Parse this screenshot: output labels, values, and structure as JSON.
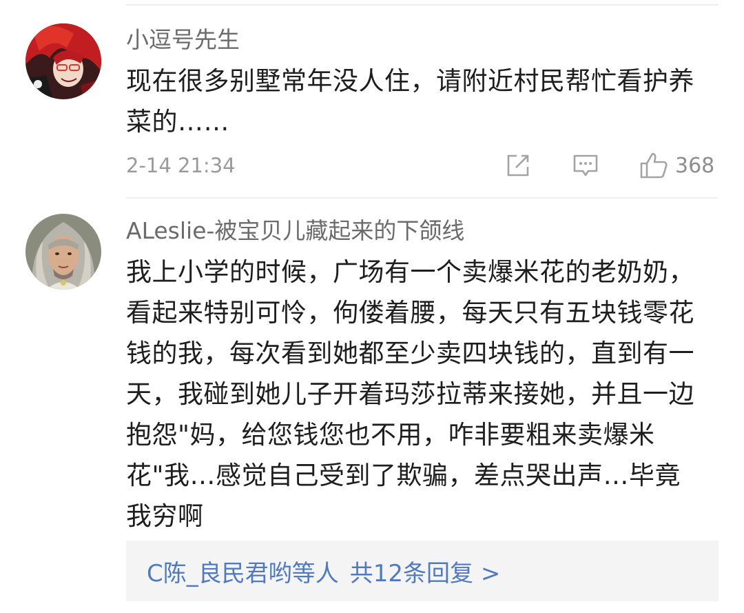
{
  "comments": [
    {
      "username": "小逗号先生",
      "avatar_icon": "avatar-red-haired-anime-character",
      "body_lines": [
        "现在很多别墅常年没人住，请附近村民帮忙看护养",
        "菜的……"
      ],
      "timestamp": "2-14 21:34",
      "actions": {
        "share_icon": "share-icon",
        "reply_icon": "comment-icon",
        "like_icon": "thumbs-up-icon",
        "like_count": "368"
      }
    },
    {
      "username": "ALeslie-被宝贝儿藏起来的下颌线",
      "avatar_icon": "avatar-grey-haired-portrait",
      "body_lines": [
        "我上小学的时候，广场有一个卖爆米花的老奶奶，",
        "看起来特别可怜，佝偻着腰，每天只有五块钱零花",
        "钱的我，每次看到她都至少卖四块钱的，直到有一",
        "天，我碰到她儿子开着玛莎拉蒂来接她，并且一边",
        "抱怨\"妈，给您钱您也不用，咋非要粗来卖爆米",
        "花\"我…感觉自己受到了欺骗，差点哭出声…毕竟",
        "我穷啊"
      ],
      "replies": {
        "from": "C陈_良民君哟等人",
        "summary": "共12条回复 >"
      }
    }
  ],
  "colors": {
    "username": "#6b6b6b",
    "body": "#1e1e1e",
    "meta": "#9a9a9a",
    "link": "#4f7ac0",
    "reply_bg": "#f4f4f4"
  }
}
